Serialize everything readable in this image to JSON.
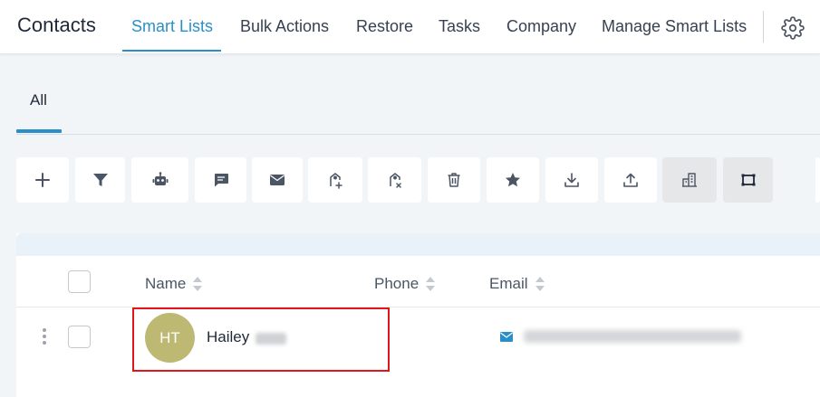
{
  "header": {
    "title": "Contacts",
    "tabs": [
      {
        "label": "Smart Lists",
        "active": true
      },
      {
        "label": "Bulk Actions",
        "active": false
      },
      {
        "label": "Restore",
        "active": false
      },
      {
        "label": "Tasks",
        "active": false
      },
      {
        "label": "Company",
        "active": false
      },
      {
        "label": "Manage Smart Lists",
        "active": false
      }
    ],
    "settings_icon": "gear-icon",
    "accent_color": "#2a8fc9"
  },
  "subtabs": [
    {
      "label": "All",
      "active": true
    }
  ],
  "toolbar": {
    "buttons": [
      {
        "icon": "plus-icon"
      },
      {
        "icon": "filter-icon"
      },
      {
        "icon": "robot-icon"
      },
      {
        "icon": "message-icon"
      },
      {
        "icon": "mail-icon"
      },
      {
        "icon": "tag-add-icon"
      },
      {
        "icon": "tag-remove-icon"
      },
      {
        "icon": "trash-icon"
      },
      {
        "icon": "star-icon"
      },
      {
        "icon": "download-icon"
      },
      {
        "icon": "upload-icon"
      },
      {
        "icon": "building-icon"
      },
      {
        "icon": "merge-icon"
      }
    ]
  },
  "table": {
    "columns": [
      "Name",
      "Phone",
      "Email"
    ],
    "rows": [
      {
        "initials": "HT",
        "first_name": "Hailey",
        "phone": "",
        "avatar_color": "#bdb972"
      }
    ]
  },
  "highlight_color": "#e0161b"
}
